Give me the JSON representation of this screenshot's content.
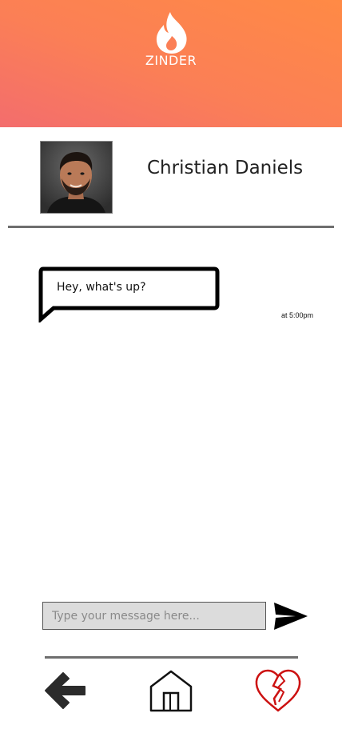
{
  "header": {
    "brand": "ZINDER",
    "logo_icon": "flame-icon",
    "gradient_start": "#f36d6d",
    "gradient_end": "#ff8a45"
  },
  "contact": {
    "name": "Christian Daniels",
    "avatar_icon": "profile-photo"
  },
  "messages": [
    {
      "text": "Hey, what's up?",
      "time": "at 5:00pm"
    }
  ],
  "composer": {
    "placeholder": "Type your message here...",
    "send_icon": "send-icon"
  },
  "nav": {
    "back_icon": "arrow-left-icon",
    "home_icon": "home-icon",
    "unmatch_icon": "broken-heart-icon",
    "unmatch_color": "#cc1111"
  }
}
